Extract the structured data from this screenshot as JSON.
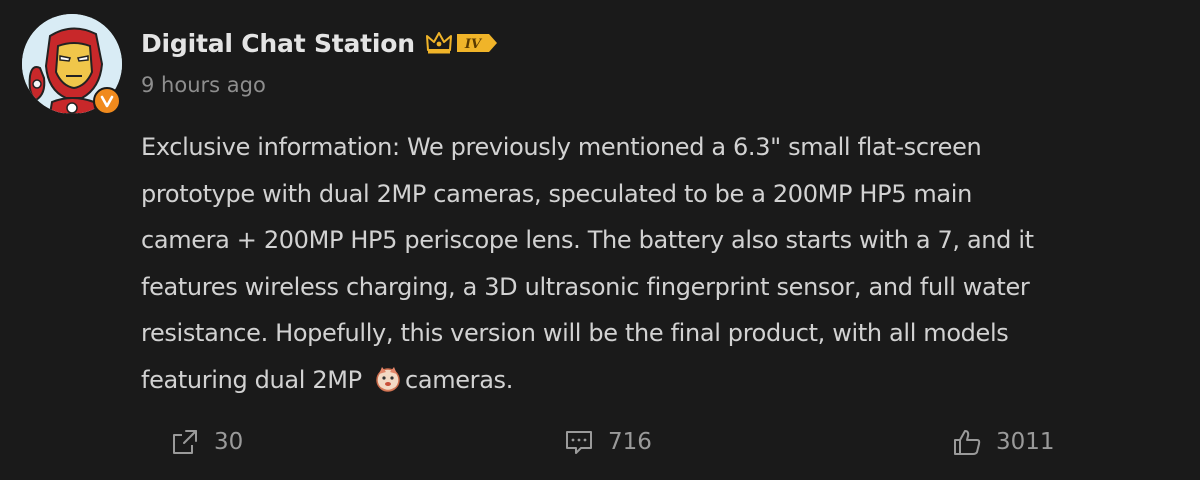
{
  "author": {
    "name": "Digital Chat Station",
    "level_badge": "IV",
    "avatar_icon": "iron-man-avatar",
    "verified_icon": "verified-v-icon",
    "crown_icon": "crown-icon"
  },
  "post": {
    "timestamp": "9 hours ago",
    "lines": [
      "Exclusive information: We previously mentioned a 6.3\" small flat-screen",
      "prototype with dual 2MP cameras, speculated to be a 200MP HP5 main",
      "camera + 200MP HP5 periscope lens. The battery also starts with a 7, and it",
      "features wireless charging, a 3D ultrasonic fingerprint sensor, and full water",
      "resistance. Hopefully, this version will be the final product, with all models"
    ],
    "last_line_before": "featuring dual 2MP ",
    "last_line_emoji": "doge-emoji-icon",
    "last_line_after": "cameras."
  },
  "actions": {
    "share_count": "30",
    "comment_count": "716",
    "like_count": "3011"
  },
  "colors": {
    "background": "#1a1a1a",
    "text": "#d2d2d2",
    "muted": "#8e8e8e",
    "badge_gold": "#f0b429",
    "verified_orange": "#f08a1d"
  }
}
